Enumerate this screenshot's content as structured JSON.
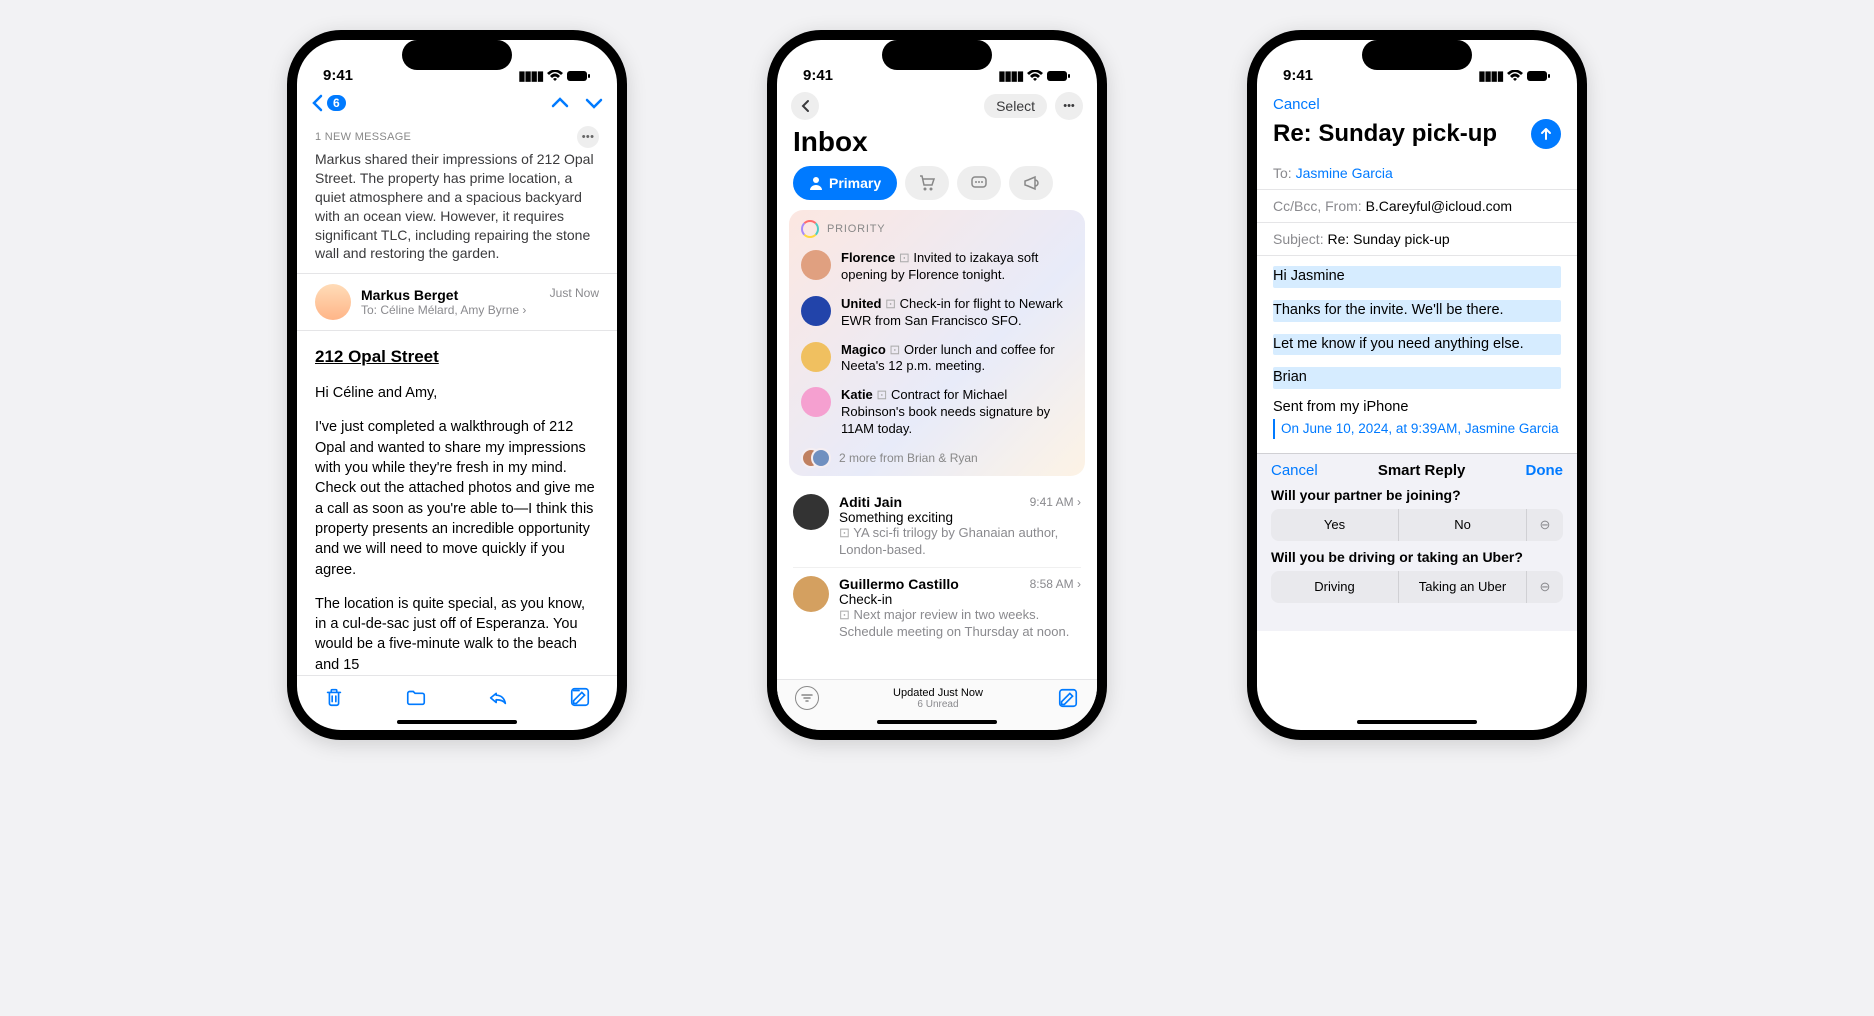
{
  "status": {
    "time": "9:41"
  },
  "phone1": {
    "nav_badge": "6",
    "summary_header": "1 NEW MESSAGE",
    "summary_text": "Markus shared their impressions of 212 Opal Street. The property has prime location, a quiet atmosphere and a spacious backyard with an ocean view. However, it requires significant TLC, including repairing the stone wall and restoring the garden.",
    "sender_name": "Markus Berget",
    "sender_to": "To: Céline Mélard, Amy Byrne",
    "sent_time": "Just Now",
    "subject": "212 Opal Street",
    "greeting": "Hi Céline and Amy,",
    "para1": "I've just completed a walkthrough of 212 Opal and wanted to share my impressions with you while they're fresh in my mind. Check out the attached photos and give me a call as soon as you're able to—I think this property presents an incredible opportunity and we will need to move quickly if you agree.",
    "para2": "The location is quite special, as you know, in a cul-de-sac just off of Esperanza. You would be a five-minute walk to the beach and 15"
  },
  "phone2": {
    "select_label": "Select",
    "title": "Inbox",
    "primary_tab": "Primary",
    "priority_label": "PRIORITY",
    "priority": [
      {
        "name": "Florence",
        "text": "Invited to izakaya soft opening by Florence tonight.",
        "color": "#e0a080"
      },
      {
        "name": "United",
        "text": "Check-in for flight to Newark EWR from San Francisco SFO.",
        "color": "#2244aa"
      },
      {
        "name": "Magico",
        "text": "Order lunch and coffee for Neeta's 12 p.m. meeting.",
        "color": "#f0c060"
      },
      {
        "name": "Katie",
        "text": "Contract for Michael Robinson's book needs signature by 11AM today.",
        "color": "#f5a0d0"
      }
    ],
    "priority_more": "2 more from Brian & Ryan",
    "messages": [
      {
        "from": "Aditi Jain",
        "time": "9:41 AM",
        "subject": "Something exciting",
        "preview": "YA sci-fi trilogy by Ghanaian author, London-based.",
        "color": "#333"
      },
      {
        "from": "Guillermo Castillo",
        "time": "8:58 AM",
        "subject": "Check-in",
        "preview": "Next major review in two weeks. Schedule meeting on Thursday at noon.",
        "color": "#d4a060"
      }
    ],
    "footer_updated": "Updated Just Now",
    "footer_unread": "6 Unread"
  },
  "phone3": {
    "cancel": "Cancel",
    "title": "Re: Sunday pick-up",
    "to_label": "To:",
    "to_value": "Jasmine Garcia",
    "cc_label": "Cc/Bcc, From:",
    "cc_value": "B.Careyful@icloud.com",
    "subject_label": "Subject:",
    "subject_value": "Re: Sunday pick-up",
    "body_greeting": "Hi Jasmine",
    "body_line1": "Thanks for the invite. We'll be there.",
    "body_line2": "Let me know if you need anything else.",
    "body_sign": "Brian",
    "signature": "Sent from my iPhone",
    "quote": "On June 10, 2024, at 9:39AM, Jasmine Garcia",
    "smart": {
      "cancel": "Cancel",
      "title": "Smart Reply",
      "done": "Done",
      "q1": "Will your partner be joining?",
      "q1_opts": [
        "Yes",
        "No"
      ],
      "q2": "Will you be driving or taking an Uber?",
      "q2_opts": [
        "Driving",
        "Taking an Uber"
      ]
    }
  }
}
